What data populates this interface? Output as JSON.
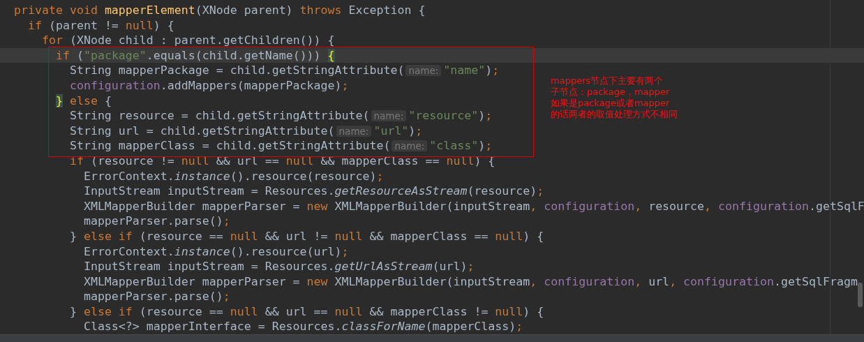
{
  "editor": {
    "lines": [
      {
        "current": false,
        "tokens": [
          {
            "kind": "kw",
            "text": "private void "
          },
          {
            "kind": "decl",
            "text": "mapperElement"
          },
          {
            "kind": "p",
            "text": "(XNode parent) "
          },
          {
            "kind": "kw",
            "text": "throws "
          },
          {
            "kind": "p",
            "text": "Exception {"
          }
        ]
      },
      {
        "current": false,
        "tokens": [
          {
            "kind": "kw",
            "text": "  if "
          },
          {
            "kind": "p",
            "text": "(parent != "
          },
          {
            "kind": "kw",
            "text": "null"
          },
          {
            "kind": "p",
            "text": ") {"
          }
        ]
      },
      {
        "current": false,
        "tokens": [
          {
            "kind": "kw",
            "text": "    for "
          },
          {
            "kind": "p",
            "text": "(XNode child : parent.getChildren()) {"
          }
        ]
      },
      {
        "current": true,
        "tokens": [
          {
            "kind": "kw",
            "text": "      if "
          },
          {
            "kind": "p",
            "text": "("
          },
          {
            "kind": "str",
            "text": "\"package\""
          },
          {
            "kind": "p",
            "text": ".equals(child.getName())) "
          },
          {
            "kind": "match",
            "text": "{"
          }
        ]
      },
      {
        "current": false,
        "tokens": [
          {
            "kind": "p",
            "text": "        String mapperPackage = child.getStringAttribute("
          },
          {
            "kind": "hint",
            "text": "name:"
          },
          {
            "kind": "str",
            "text": "\"name\""
          },
          {
            "kind": "p",
            "text": ")"
          },
          {
            "kind": "kw",
            "text": ";"
          }
        ]
      },
      {
        "current": false,
        "tokens": [
          {
            "kind": "field",
            "text": "        configuration"
          },
          {
            "kind": "p",
            "text": ".addMappers(mapperPackage)"
          },
          {
            "kind": "kw",
            "text": ";"
          }
        ]
      },
      {
        "current": false,
        "tokens": [
          {
            "kind": "match",
            "text": "      }"
          },
          {
            "kind": "kw",
            "text": " else "
          },
          {
            "kind": "p",
            "text": "{"
          }
        ]
      },
      {
        "current": false,
        "tokens": [
          {
            "kind": "p",
            "text": "        String resource = child.getStringAttribute("
          },
          {
            "kind": "hint",
            "text": "name:"
          },
          {
            "kind": "str",
            "text": "\"resource\""
          },
          {
            "kind": "p",
            "text": ")"
          },
          {
            "kind": "kw",
            "text": ";"
          }
        ]
      },
      {
        "current": false,
        "tokens": [
          {
            "kind": "p",
            "text": "        String url = child.getStringAttribute("
          },
          {
            "kind": "hint",
            "text": "name:"
          },
          {
            "kind": "str",
            "text": "\"url\""
          },
          {
            "kind": "p",
            "text": ")"
          },
          {
            "kind": "kw",
            "text": ";"
          }
        ]
      },
      {
        "current": false,
        "tokens": [
          {
            "kind": "p",
            "text": "        String mapperClass = child.getStringAttribute("
          },
          {
            "kind": "hint",
            "text": "name:"
          },
          {
            "kind": "str",
            "text": "\"class\""
          },
          {
            "kind": "p",
            "text": ")"
          },
          {
            "kind": "kw",
            "text": ";"
          }
        ]
      },
      {
        "current": false,
        "tokens": [
          {
            "kind": "kw",
            "text": "        if "
          },
          {
            "kind": "p",
            "text": "(resource != "
          },
          {
            "kind": "kw",
            "text": "null "
          },
          {
            "kind": "p",
            "text": "&& url == "
          },
          {
            "kind": "kw",
            "text": "null "
          },
          {
            "kind": "p",
            "text": "&& mapperClass == "
          },
          {
            "kind": "kw",
            "text": "null"
          },
          {
            "kind": "p",
            "text": ") {"
          }
        ]
      },
      {
        "current": false,
        "tokens": [
          {
            "kind": "p",
            "text": "          ErrorContext."
          },
          {
            "kind": "ital",
            "text": "instance"
          },
          {
            "kind": "p",
            "text": "().resource(resource)"
          },
          {
            "kind": "kw",
            "text": ";"
          }
        ]
      },
      {
        "current": false,
        "tokens": [
          {
            "kind": "p",
            "text": "          InputStream inputStream = Resources."
          },
          {
            "kind": "ital",
            "text": "getResourceAsStream"
          },
          {
            "kind": "p",
            "text": "(resource)"
          },
          {
            "kind": "kw",
            "text": ";"
          }
        ]
      },
      {
        "current": false,
        "tokens": [
          {
            "kind": "p",
            "text": "          XMLMapperBuilder mapperParser = "
          },
          {
            "kind": "kw",
            "text": "new "
          },
          {
            "kind": "p",
            "text": "XMLMapperBuilder(inputStream"
          },
          {
            "kind": "kw",
            "text": ", "
          },
          {
            "kind": "field",
            "text": "configuration"
          },
          {
            "kind": "kw",
            "text": ", "
          },
          {
            "kind": "p",
            "text": "resource"
          },
          {
            "kind": "kw",
            "text": ", "
          },
          {
            "kind": "field",
            "text": "configuration"
          },
          {
            "kind": "p",
            "text": ".getSqlF"
          }
        ]
      },
      {
        "current": false,
        "tokens": [
          {
            "kind": "p",
            "text": "          mapperParser.parse()"
          },
          {
            "kind": "kw",
            "text": ";"
          }
        ]
      },
      {
        "current": false,
        "tokens": [
          {
            "kind": "p",
            "text": "        } "
          },
          {
            "kind": "kw",
            "text": "else if "
          },
          {
            "kind": "p",
            "text": "(resource == "
          },
          {
            "kind": "kw",
            "text": "null "
          },
          {
            "kind": "p",
            "text": "&& url != "
          },
          {
            "kind": "kw",
            "text": "null "
          },
          {
            "kind": "p",
            "text": "&& mapperClass == "
          },
          {
            "kind": "kw",
            "text": "null"
          },
          {
            "kind": "p",
            "text": ") {"
          }
        ]
      },
      {
        "current": false,
        "tokens": [
          {
            "kind": "p",
            "text": "          ErrorContext."
          },
          {
            "kind": "ital",
            "text": "instance"
          },
          {
            "kind": "p",
            "text": "().resource(url)"
          },
          {
            "kind": "kw",
            "text": ";"
          }
        ]
      },
      {
        "current": false,
        "tokens": [
          {
            "kind": "p",
            "text": "          InputStream inputStream = Resources."
          },
          {
            "kind": "ital",
            "text": "getUrlAsStream"
          },
          {
            "kind": "p",
            "text": "(url)"
          },
          {
            "kind": "kw",
            "text": ";"
          }
        ]
      },
      {
        "current": false,
        "tokens": [
          {
            "kind": "p",
            "text": "          XMLMapperBuilder mapperParser = "
          },
          {
            "kind": "kw",
            "text": "new "
          },
          {
            "kind": "p",
            "text": "XMLMapperBuilder(inputStream"
          },
          {
            "kind": "kw",
            "text": ", "
          },
          {
            "kind": "field",
            "text": "configuration"
          },
          {
            "kind": "kw",
            "text": ", "
          },
          {
            "kind": "p",
            "text": "url"
          },
          {
            "kind": "kw",
            "text": ", "
          },
          {
            "kind": "field",
            "text": "configuration"
          },
          {
            "kind": "p",
            "text": ".getSqlFragm"
          }
        ]
      },
      {
        "current": false,
        "tokens": [
          {
            "kind": "p",
            "text": "          mapperParser.parse()"
          },
          {
            "kind": "kw",
            "text": ";"
          }
        ]
      },
      {
        "current": false,
        "tokens": [
          {
            "kind": "p",
            "text": "        } "
          },
          {
            "kind": "kw",
            "text": "else if "
          },
          {
            "kind": "p",
            "text": "(resource == "
          },
          {
            "kind": "kw",
            "text": "null "
          },
          {
            "kind": "p",
            "text": "&& url == "
          },
          {
            "kind": "kw",
            "text": "null "
          },
          {
            "kind": "p",
            "text": "&& mapperClass != "
          },
          {
            "kind": "kw",
            "text": "null"
          },
          {
            "kind": "p",
            "text": ") {"
          }
        ]
      },
      {
        "current": false,
        "tokens": [
          {
            "kind": "p",
            "text": "          Class<?> mapperInterface = Resources."
          },
          {
            "kind": "ital",
            "text": "classForName"
          },
          {
            "kind": "p",
            "text": "(mapperClass)"
          },
          {
            "kind": "kw",
            "text": ";"
          }
        ]
      }
    ]
  },
  "annotation": {
    "lines": [
      "mappers节点下主要有两个",
      "子节点：package，mapper",
      "如果是package或者mapper",
      "的话两者的取值处理方式不相同"
    ]
  }
}
